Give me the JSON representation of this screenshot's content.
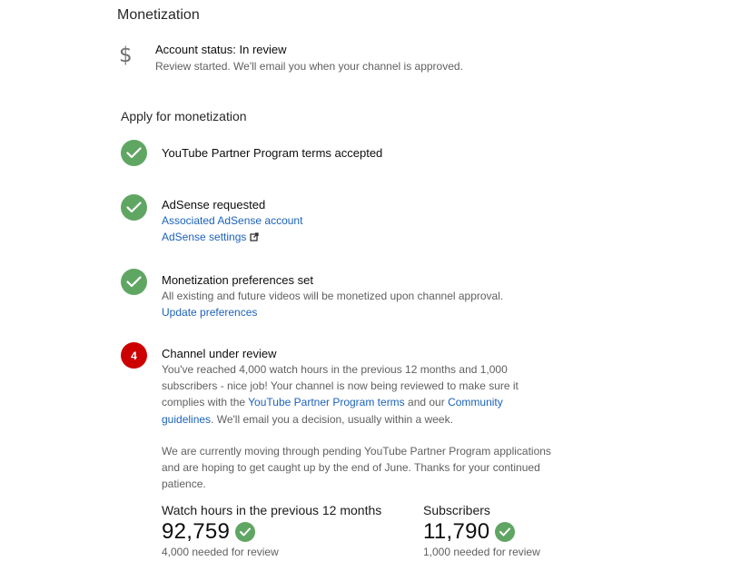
{
  "page_title": "Monetization",
  "account_status": {
    "icon": "dollar-icon",
    "title": "Account status: In review",
    "description": "Review started. We'll email you when your channel is approved."
  },
  "apply_section": {
    "title": "Apply for monetization",
    "steps": [
      {
        "state": "done",
        "title": "YouTube Partner Program terms accepted"
      },
      {
        "state": "done",
        "title": "AdSense requested",
        "link_account": "Associated AdSense account",
        "link_settings": "AdSense settings",
        "link_settings_icon": "external-link-icon"
      },
      {
        "state": "done",
        "title": "Monetization preferences set",
        "text": "All existing and future videos will be monetized upon channel approval.",
        "link": "Update preferences"
      },
      {
        "state": "current",
        "number": "4",
        "title": "Channel under review",
        "para1_a": "You've reached 4,000 watch hours in the previous 12 months and 1,000 subscribers - nice job! Your channel is now being reviewed to make sure it complies with the ",
        "para1_link1": "YouTube Partner Program terms",
        "para1_b": " and our ",
        "para1_link2": "Community guidelines",
        "para1_c": ". We'll email you a decision, usually within a week.",
        "para2": "We are currently moving through pending YouTube Partner Program applications and are hoping to get caught up by the end of June. Thanks for your continued patience."
      }
    ]
  },
  "metrics": {
    "watch_hours": {
      "label": "Watch hours in the previous 12 months",
      "value": "92,759",
      "note": "4,000 needed for review",
      "met": true
    },
    "subscribers": {
      "label": "Subscribers",
      "value": "11,790",
      "note": "1,000 needed for review",
      "met": true
    }
  },
  "colors": {
    "success_green": "#60a663",
    "step_red": "#cc0000",
    "link_blue": "#1c62b9",
    "secondary_text": "#606060"
  }
}
